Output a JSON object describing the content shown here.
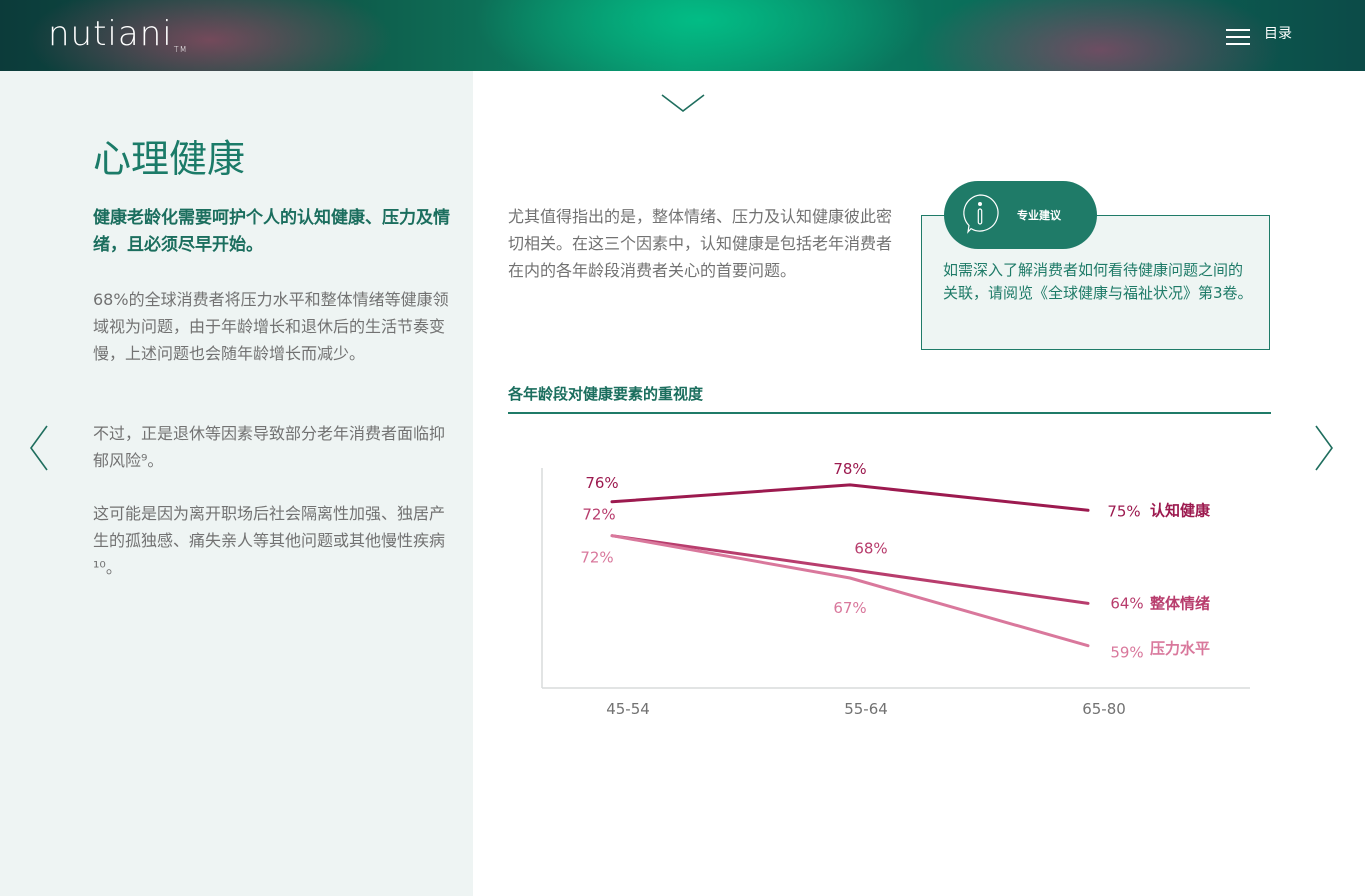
{
  "header": {
    "logo": "nutiani",
    "logo_tm": "TM",
    "menu_label": "目录"
  },
  "left": {
    "title": "心理健康",
    "lead": "健康老龄化需要呵护个人的认知健康、压力及情绪，且必须尽早开始。",
    "paragraphs": [
      "68%的全球消费者将压力水平和整体情绪等健康领域视为问题，由于年龄增长和退休后的生活节奏变慢，上述问题也会随年龄增长而减少。",
      "不过，正是退休等因素导致部分老年消费者面临抑郁风险⁹。",
      "这可能是因为离开职场后社会隔离性加强、独居产生的孤独感、痛失亲人等其他问题或其他慢性疾病¹⁰。"
    ]
  },
  "main": {
    "intro": "尤其值得指出的是，整体情绪、压力及认知健康彼此密切相关。在这三个因素中，认知健康是包括老年消费者在内的各年龄段消费者关心的首要问题。",
    "advice_tag": "专业建议",
    "advice_text": "如需深入了解消费者如何看待健康问题之间的关联，请阅览《全球健康与福祉状况》第3卷。"
  },
  "icons": {
    "menu": "hamburger-icon",
    "prev": "chevron-left-icon",
    "next": "chevron-right-icon",
    "down": "chevron-down-icon",
    "advice": "info-icon"
  },
  "colors": {
    "brand_green": "#1f7b68",
    "series_cognitive": "#9c1a4f",
    "series_mood": "#b83d6d",
    "series_stress": "#d9789c"
  },
  "chart_data": {
    "type": "line",
    "title": "各年龄段对健康要素的重视度",
    "categories": [
      "45-54",
      "55-64",
      "65-80"
    ],
    "series": [
      {
        "name": "认知健康",
        "values": [
          76,
          78,
          75
        ],
        "labels": [
          "76%",
          "78%",
          "75%"
        ],
        "color": "#9c1a4f"
      },
      {
        "name": "整体情绪",
        "values": [
          72,
          68,
          64
        ],
        "labels": [
          "72%",
          "68%",
          "64%"
        ],
        "color": "#b83d6d"
      },
      {
        "name": "压力水平",
        "values": [
          72,
          67,
          59
        ],
        "labels": [
          "72%",
          "67%",
          "59%"
        ],
        "color": "#d9789c"
      }
    ],
    "ylim": [
      54,
      80
    ],
    "grid": false,
    "legend": "right end of lines"
  }
}
